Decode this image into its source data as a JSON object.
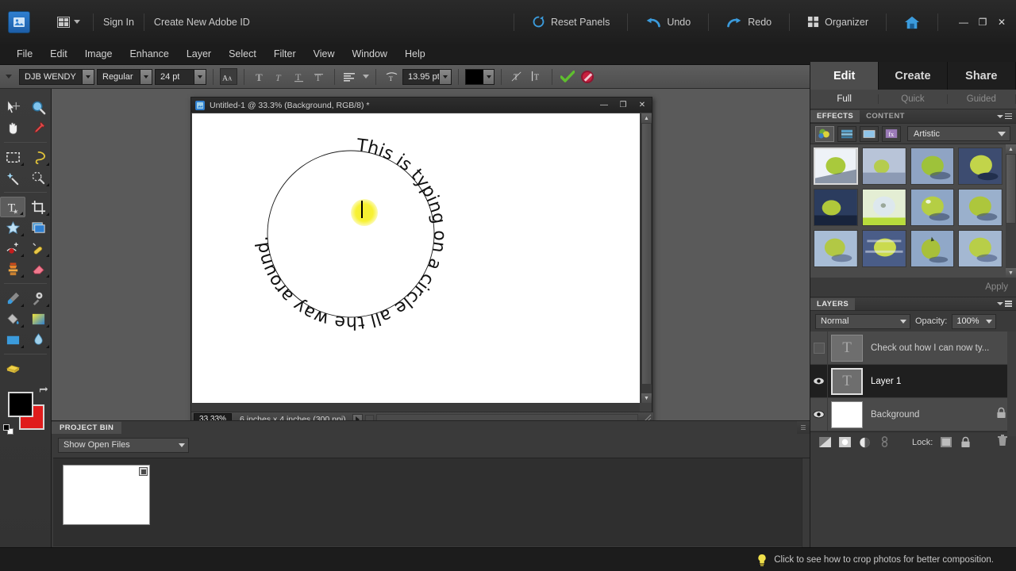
{
  "topbar": {
    "logo_icon": "photoshop-elements-logo",
    "layout_icon": "layout-grid-icon",
    "sign_in": "Sign In",
    "create_id": "Create New Adobe ID",
    "reset_panels": "Reset Panels",
    "undo": "Undo",
    "redo": "Redo",
    "organizer": "Organizer",
    "home_icon": "home-icon",
    "minimize": "—",
    "maximize": "❐",
    "close": "✕"
  },
  "menubar": {
    "items": [
      "File",
      "Edit",
      "Image",
      "Enhance",
      "Layer",
      "Select",
      "Filter",
      "View",
      "Window",
      "Help"
    ]
  },
  "options_bar": {
    "font_family": "DJB WENDY",
    "font_style": "Regular",
    "font_size": "24 pt",
    "leading": "13.95 pt",
    "antialias_icon": "anti-alias-icon",
    "style_buttons": [
      "bold-icon",
      "italic-icon",
      "underline-icon",
      "strikethrough-icon"
    ],
    "align_icon": "align-left-icon",
    "warp_icon": "warp-text-icon",
    "text_color": "#000000",
    "orientation_icons": [
      "text-orientation-icon",
      "vertical-text-icon"
    ],
    "commit_icon": "commit-checkmark-icon",
    "cancel_icon": "cancel-icon"
  },
  "toolbox": {
    "tools": [
      "move-tool",
      "zoom-tool",
      "hand-tool",
      "eyedropper-tool",
      "rectangular-marquee-tool",
      "lasso-tool",
      "magic-wand-tool",
      "quick-selection-tool",
      "type-tool",
      "crop-tool",
      "cookie-cutter-tool",
      "straighten-tool",
      "red-eye-removal-tool",
      "healing-brush-tool",
      "clone-stamp-tool",
      "eraser-tool",
      "brush-tool",
      "smart-brush-tool",
      "paint-bucket-tool",
      "gradient-tool",
      "shape-tool",
      "blur-tool",
      "sponge-tool"
    ],
    "selected_tool": "type-tool",
    "foreground_color": "#000000",
    "background_color": "#e01c1c",
    "swap_icon": "swap-colors-icon",
    "default_colors_icon": "default-colors-icon"
  },
  "document": {
    "title": "Untitled-1 @ 33.3% (Background, RGB/8) *",
    "window_icon": "document-icon",
    "minimize": "—",
    "maximize": "❐",
    "close": "✕",
    "zoom_level": "33.33%",
    "dimensions": "6 inches x 4 inches (300 ppi)",
    "canvas_text": "This is typing on a circle all the way around.",
    "canvas_bg": "#ffffff",
    "highlight_color": "#f5ef32"
  },
  "project_bin": {
    "title": "PROJECT BIN",
    "filter": "Show Open Files",
    "thumbnail_label": "thumbnail"
  },
  "right_panel": {
    "mode_tabs": [
      {
        "label": "Edit",
        "active": true
      },
      {
        "label": "Create",
        "active": false
      },
      {
        "label": "Share",
        "active": false
      }
    ],
    "sub_tabs": [
      {
        "label": "Full",
        "active": true
      },
      {
        "label": "Quick",
        "active": false
      },
      {
        "label": "Guided",
        "active": false
      }
    ],
    "effects": {
      "tab_effects": "EFFECTS",
      "tab_content": "CONTENT",
      "category": "Artistic",
      "icons": [
        "filters-icon",
        "layer-styles-icon",
        "photo-effects-icon",
        "show-all-icon"
      ],
      "apply_label": "Apply",
      "thumbnail_count": 14
    },
    "layers": {
      "title": "LAYERS",
      "blend_mode": "Normal",
      "opacity_label": "Opacity:",
      "opacity_value": "100%",
      "rows": [
        {
          "name": "Check out how I can now ty...",
          "visible": false,
          "active": false,
          "type": "text",
          "locked": false
        },
        {
          "name": "Layer 1",
          "visible": true,
          "active": true,
          "type": "text",
          "locked": false
        },
        {
          "name": "Background",
          "visible": true,
          "active": false,
          "type": "image",
          "locked": true
        }
      ],
      "bottom_icons": [
        "new-adjustment-layer-icon",
        "new-layer-icon",
        "new-fill-layer-icon",
        "link-layers-icon"
      ],
      "lock_label": "Lock:",
      "lock_icons": [
        "lock-transparency-icon",
        "lock-all-icon"
      ],
      "delete_icon": "trash-icon"
    }
  },
  "statusbar": {
    "hint_icon": "lightbulb-icon",
    "hint": "Click to see how to crop photos for better composition."
  },
  "colors": {
    "accent_blue": "#2f7fd0",
    "commit_green": "#5fbf2e",
    "cancel_red": "#c8203e",
    "panel_bg": "#3a3a3a",
    "toolbar_bg": "#4e4e4e"
  }
}
